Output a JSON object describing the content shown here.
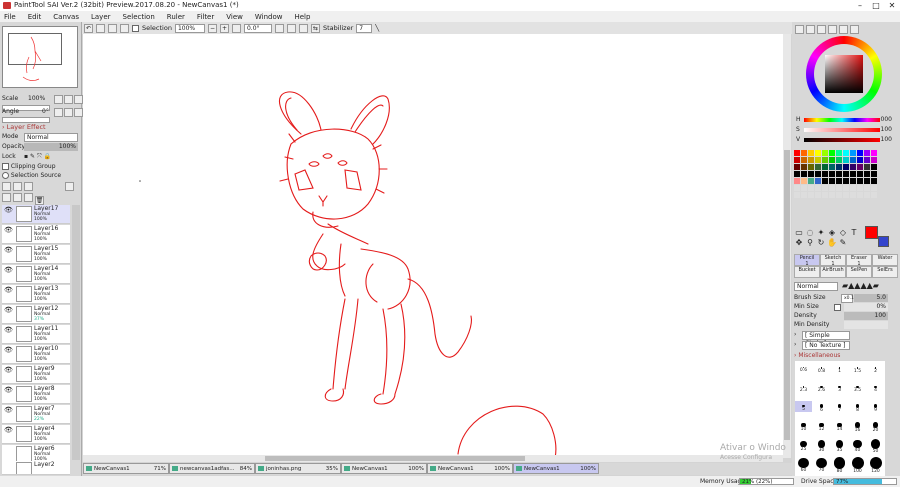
{
  "window": {
    "title": "PaintTool SAI Ver.2 (32bit) Preview.2017.08.20 - NewCanvas1 (*)",
    "controls": [
      "–",
      "□",
      "✕"
    ]
  },
  "menu": [
    "File",
    "Edit",
    "Canvas",
    "Layer",
    "Selection",
    "Ruler",
    "Filter",
    "View",
    "Window",
    "Help"
  ],
  "toolbar": {
    "selection_label": "Selection",
    "zoom": "100%",
    "angle": "0.0°",
    "stabilizer_label": "Stabilizer",
    "stabilizer": "7"
  },
  "left": {
    "scale_label": "Scale",
    "scale": "100%",
    "angle_label": "Angle",
    "angle": "0°",
    "layer_effect": "Layer Effect",
    "mode_label": "Mode",
    "mode": "Normal",
    "opacity_label": "Opacity",
    "opacity": "100%",
    "lock_label": "Lock",
    "clipping": "Clipping Group",
    "selection_source": "Selection Source",
    "layers": [
      {
        "name": "Layer17",
        "mode": "Normal",
        "opacity": "100%",
        "sel": true
      },
      {
        "name": "Layer16",
        "mode": "Normal",
        "opacity": "100%"
      },
      {
        "name": "Layer15",
        "mode": "Normal",
        "opacity": "100%"
      },
      {
        "name": "Layer14",
        "mode": "Normal",
        "opacity": "100%"
      },
      {
        "name": "Layer13",
        "mode": "Normal",
        "opacity": "100%"
      },
      {
        "name": "Layer12",
        "mode": "Normal",
        "opacity": "37%"
      },
      {
        "name": "Layer11",
        "mode": "Normal",
        "opacity": "100%"
      },
      {
        "name": "Layer10",
        "mode": "Normal",
        "opacity": "100%"
      },
      {
        "name": "Layer9",
        "mode": "Normal",
        "opacity": "100%"
      },
      {
        "name": "Layer8",
        "mode": "Normal",
        "opacity": "100%"
      },
      {
        "name": "Layer7",
        "mode": "Normal",
        "opacity": "22%"
      },
      {
        "name": "Layer4",
        "mode": "Normal",
        "opacity": "100%"
      },
      {
        "name": "Layer6",
        "mode": "Normal",
        "opacity": "100%"
      },
      {
        "name": "Layer2",
        "mode": "",
        "opacity": ""
      }
    ]
  },
  "tabs": [
    {
      "name": "NewCanvas1",
      "zoom": "71%"
    },
    {
      "name": "newcanvas1adfas...",
      "zoom": "84%"
    },
    {
      "name": "joninhas.png",
      "zoom": "35%"
    },
    {
      "name": "NewCanvas1",
      "zoom": "100%"
    },
    {
      "name": "NewCanvas1",
      "zoom": "100%"
    },
    {
      "name": "NewCanvas1",
      "zoom": "100%",
      "active": true
    }
  ],
  "status": {
    "memory_label": "Memory Usage",
    "memory": "21% (22%)",
    "memory_fraction": 0.21,
    "drive_label": "Drive Space",
    "drive": "77%",
    "drive_fraction": 0.77
  },
  "watermark": {
    "line1": "Ativar o Windo",
    "line2": "Acesse Configura"
  },
  "right": {
    "h_label": "H",
    "h": "000",
    "s_label": "S",
    "s": "100",
    "v_label": "V",
    "v": "100",
    "primary_color": "#ff0000",
    "secondary_color": "#3344cc",
    "brushes": [
      {
        "name": "Pencil",
        "size": "1",
        "active": true
      },
      {
        "name": "Sketch",
        "size": "1"
      },
      {
        "name": "Eraser",
        "size": "1"
      },
      {
        "name": "Water",
        "size": ""
      },
      {
        "name": "Bucket",
        "size": ""
      },
      {
        "name": "AirBrush",
        "size": ""
      },
      {
        "name": "SelPen",
        "size": ""
      },
      {
        "name": "SelErs",
        "size": ""
      }
    ],
    "blend": "Normal",
    "brush_size_label": "Brush Size",
    "brush_size_mult": "x0.1",
    "brush_size": "5.0",
    "min_size_label": "Min Size",
    "min_size": "0%",
    "density_label": "Density",
    "density": "100",
    "min_density_label": "Min Density",
    "shape": "[ Simple Circle ]",
    "texture": "[ No Texture ]",
    "misc_label": "Miscellaneous",
    "dot_sizes": [
      "0.6",
      "0.8",
      "1",
      "1.5",
      "2",
      "2.3",
      "2.6",
      "3",
      "3.5",
      "4",
      "5",
      "6",
      "7",
      "8",
      "9",
      "10",
      "12",
      "14",
      "16",
      "20",
      "25",
      "30",
      "35",
      "40",
      "50",
      "60",
      "70",
      "80",
      "100",
      "120"
    ]
  }
}
